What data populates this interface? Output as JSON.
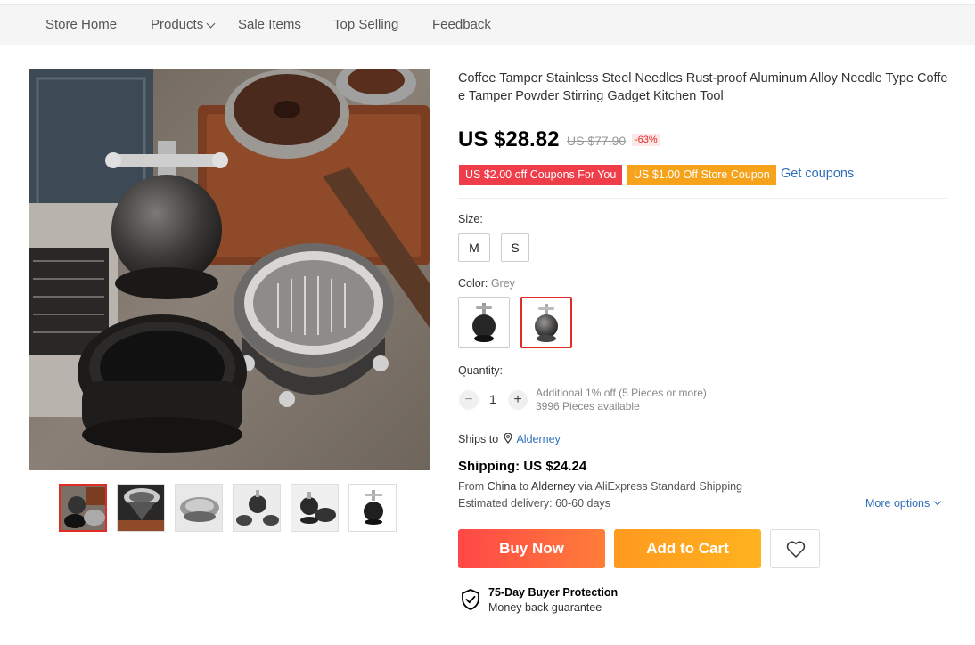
{
  "nav": {
    "items": [
      {
        "label": "Store Home",
        "dropdown": false
      },
      {
        "label": "Products",
        "dropdown": true
      },
      {
        "label": "Sale Items",
        "dropdown": false
      },
      {
        "label": "Top Selling",
        "dropdown": false
      },
      {
        "label": "Feedback",
        "dropdown": false
      }
    ]
  },
  "product": {
    "title": "Coffee Tamper Stainless Steel Needles Rust-proof Aluminum Alloy Needle Type Coffee Tamper Powder Stirring Gadget Kitchen Tool",
    "price": "US $28.82",
    "original_price": "US $77.90",
    "discount": "-63%"
  },
  "coupons": {
    "first": "US $2.00 off Coupons For You",
    "second": "US $1.00 Off Store Coupon",
    "link": "Get coupons"
  },
  "size": {
    "label": "Size:",
    "options": [
      "M",
      "S"
    ]
  },
  "color": {
    "label": "Color:",
    "selected": "Grey",
    "options": [
      "black",
      "grey"
    ]
  },
  "quantity": {
    "label": "Quantity:",
    "value": "1",
    "minus": "−",
    "plus": "+",
    "note": "Additional 1% off (5 Pieces or more)",
    "available": "3996 Pieces available"
  },
  "shipping": {
    "ships_to_label": "Ships to",
    "location": "Alderney",
    "title": "Shipping: US $24.24",
    "from_prefix": "From",
    "from_country": "China",
    "to_word": "to",
    "to_country": "Alderney",
    "via": "via AliExpress Standard Shipping",
    "delivery": "Estimated delivery: 60-60 days",
    "more_options": "More options"
  },
  "actions": {
    "buy_now": "Buy Now",
    "add_to_cart": "Add to Cart"
  },
  "protection": {
    "title": "75-Day Buyer Protection",
    "subtitle": "Money back guarantee"
  },
  "colors": {
    "accent_red": "#e02b27",
    "buy_gradient_start": "#ff4747",
    "cart_gradient_start": "#ff9a1f",
    "link_blue": "#2e6fb8",
    "coupon_red": "#ef3d4a",
    "coupon_orange": "#f7a21b"
  }
}
